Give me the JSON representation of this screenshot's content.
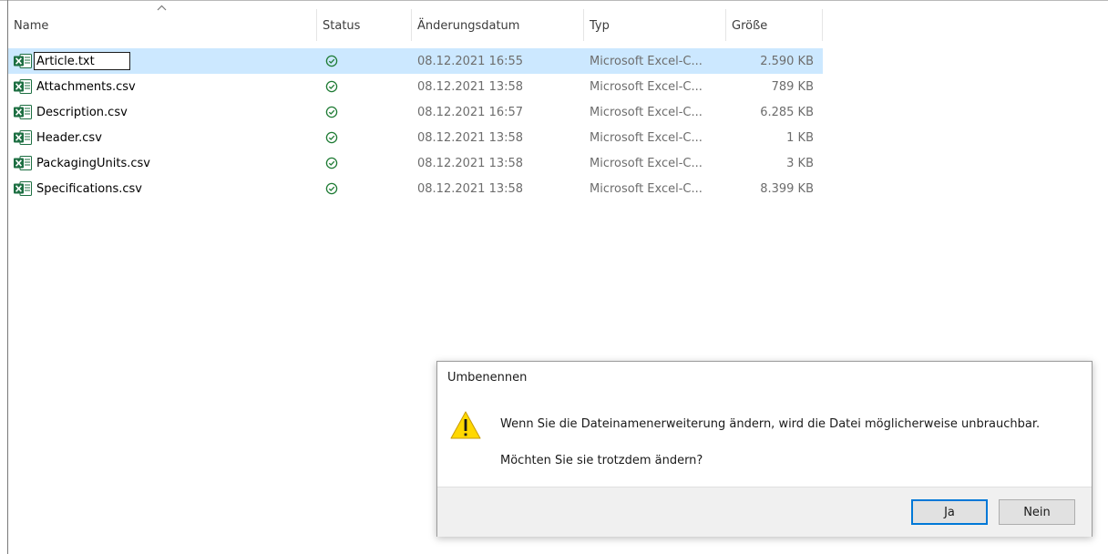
{
  "columns": {
    "name": "Name",
    "status": "Status",
    "date": "Änderungsdatum",
    "type": "Typ",
    "size": "Größe"
  },
  "sort_indicator": "chevron-up-icon",
  "files": [
    {
      "name": "Article.txt",
      "status": "synced-check-icon",
      "date": "08.12.2021 16:55",
      "type": "Microsoft Excel-C...",
      "size": "2.590 KB",
      "selected": true,
      "editing": true
    },
    {
      "name": "Attachments.csv",
      "status": "synced-check-icon",
      "date": "08.12.2021 13:58",
      "type": "Microsoft Excel-C...",
      "size": "789 KB"
    },
    {
      "name": "Description.csv",
      "status": "synced-check-icon",
      "date": "08.12.2021 16:57",
      "type": "Microsoft Excel-C...",
      "size": "6.285 KB"
    },
    {
      "name": "Header.csv",
      "status": "synced-check-icon",
      "date": "08.12.2021 13:58",
      "type": "Microsoft Excel-C...",
      "size": "1 KB"
    },
    {
      "name": "PackagingUnits.csv",
      "status": "synced-check-icon",
      "date": "08.12.2021 13:58",
      "type": "Microsoft Excel-C...",
      "size": "3 KB"
    },
    {
      "name": "Specifications.csv",
      "status": "synced-check-icon",
      "date": "08.12.2021 13:58",
      "type": "Microsoft Excel-C...",
      "size": "8.399 KB"
    }
  ],
  "dialog": {
    "title": "Umbenennen",
    "message": "Wenn Sie die Dateinamenerweiterung ändern, wird die Datei möglicherweise unbrauchbar.",
    "question": "Möchten Sie sie trotzdem ändern?",
    "yes_label": "Ja",
    "no_label": "Nein",
    "icon": "warning-icon"
  },
  "colors": {
    "selection": "#cce8ff",
    "status_green": "#1e7b34",
    "excel_green": "#1d6f42",
    "warning_yellow": "#ffd800",
    "focus_blue": "#0078d7"
  }
}
